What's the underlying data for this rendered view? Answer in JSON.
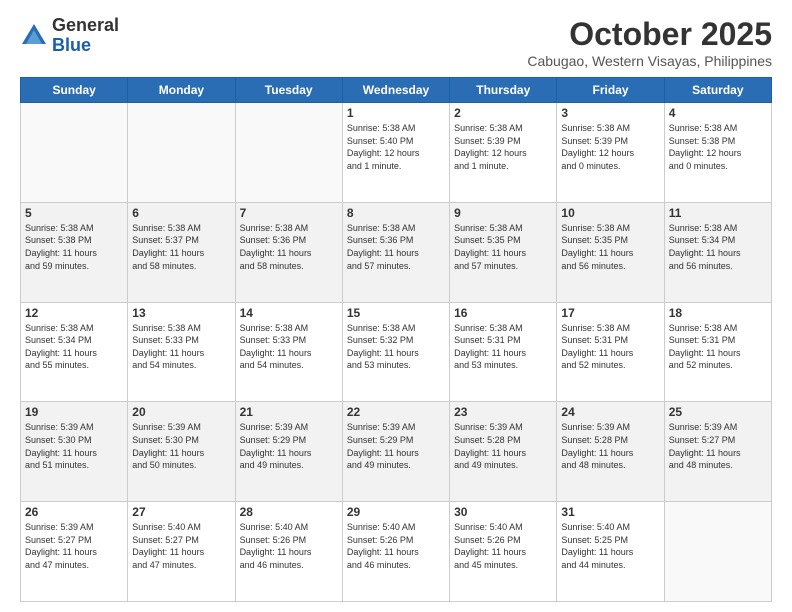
{
  "logo": {
    "general": "General",
    "blue": "Blue"
  },
  "header": {
    "month": "October 2025",
    "location": "Cabugao, Western Visayas, Philippines"
  },
  "days": [
    "Sunday",
    "Monday",
    "Tuesday",
    "Wednesday",
    "Thursday",
    "Friday",
    "Saturday"
  ],
  "weeks": [
    [
      {
        "day": "",
        "info": ""
      },
      {
        "day": "",
        "info": ""
      },
      {
        "day": "",
        "info": ""
      },
      {
        "day": "1",
        "info": "Sunrise: 5:38 AM\nSunset: 5:40 PM\nDaylight: 12 hours\nand 1 minute."
      },
      {
        "day": "2",
        "info": "Sunrise: 5:38 AM\nSunset: 5:39 PM\nDaylight: 12 hours\nand 1 minute."
      },
      {
        "day": "3",
        "info": "Sunrise: 5:38 AM\nSunset: 5:39 PM\nDaylight: 12 hours\nand 0 minutes."
      },
      {
        "day": "4",
        "info": "Sunrise: 5:38 AM\nSunset: 5:38 PM\nDaylight: 12 hours\nand 0 minutes."
      }
    ],
    [
      {
        "day": "5",
        "info": "Sunrise: 5:38 AM\nSunset: 5:38 PM\nDaylight: 11 hours\nand 59 minutes."
      },
      {
        "day": "6",
        "info": "Sunrise: 5:38 AM\nSunset: 5:37 PM\nDaylight: 11 hours\nand 58 minutes."
      },
      {
        "day": "7",
        "info": "Sunrise: 5:38 AM\nSunset: 5:36 PM\nDaylight: 11 hours\nand 58 minutes."
      },
      {
        "day": "8",
        "info": "Sunrise: 5:38 AM\nSunset: 5:36 PM\nDaylight: 11 hours\nand 57 minutes."
      },
      {
        "day": "9",
        "info": "Sunrise: 5:38 AM\nSunset: 5:35 PM\nDaylight: 11 hours\nand 57 minutes."
      },
      {
        "day": "10",
        "info": "Sunrise: 5:38 AM\nSunset: 5:35 PM\nDaylight: 11 hours\nand 56 minutes."
      },
      {
        "day": "11",
        "info": "Sunrise: 5:38 AM\nSunset: 5:34 PM\nDaylight: 11 hours\nand 56 minutes."
      }
    ],
    [
      {
        "day": "12",
        "info": "Sunrise: 5:38 AM\nSunset: 5:34 PM\nDaylight: 11 hours\nand 55 minutes."
      },
      {
        "day": "13",
        "info": "Sunrise: 5:38 AM\nSunset: 5:33 PM\nDaylight: 11 hours\nand 54 minutes."
      },
      {
        "day": "14",
        "info": "Sunrise: 5:38 AM\nSunset: 5:33 PM\nDaylight: 11 hours\nand 54 minutes."
      },
      {
        "day": "15",
        "info": "Sunrise: 5:38 AM\nSunset: 5:32 PM\nDaylight: 11 hours\nand 53 minutes."
      },
      {
        "day": "16",
        "info": "Sunrise: 5:38 AM\nSunset: 5:31 PM\nDaylight: 11 hours\nand 53 minutes."
      },
      {
        "day": "17",
        "info": "Sunrise: 5:38 AM\nSunset: 5:31 PM\nDaylight: 11 hours\nand 52 minutes."
      },
      {
        "day": "18",
        "info": "Sunrise: 5:38 AM\nSunset: 5:31 PM\nDaylight: 11 hours\nand 52 minutes."
      }
    ],
    [
      {
        "day": "19",
        "info": "Sunrise: 5:39 AM\nSunset: 5:30 PM\nDaylight: 11 hours\nand 51 minutes."
      },
      {
        "day": "20",
        "info": "Sunrise: 5:39 AM\nSunset: 5:30 PM\nDaylight: 11 hours\nand 50 minutes."
      },
      {
        "day": "21",
        "info": "Sunrise: 5:39 AM\nSunset: 5:29 PM\nDaylight: 11 hours\nand 49 minutes."
      },
      {
        "day": "22",
        "info": "Sunrise: 5:39 AM\nSunset: 5:29 PM\nDaylight: 11 hours\nand 49 minutes."
      },
      {
        "day": "23",
        "info": "Sunrise: 5:39 AM\nSunset: 5:28 PM\nDaylight: 11 hours\nand 49 minutes."
      },
      {
        "day": "24",
        "info": "Sunrise: 5:39 AM\nSunset: 5:28 PM\nDaylight: 11 hours\nand 48 minutes."
      },
      {
        "day": "25",
        "info": "Sunrise: 5:39 AM\nSunset: 5:27 PM\nDaylight: 11 hours\nand 48 minutes."
      }
    ],
    [
      {
        "day": "26",
        "info": "Sunrise: 5:39 AM\nSunset: 5:27 PM\nDaylight: 11 hours\nand 47 minutes."
      },
      {
        "day": "27",
        "info": "Sunrise: 5:40 AM\nSunset: 5:27 PM\nDaylight: 11 hours\nand 47 minutes."
      },
      {
        "day": "28",
        "info": "Sunrise: 5:40 AM\nSunset: 5:26 PM\nDaylight: 11 hours\nand 46 minutes."
      },
      {
        "day": "29",
        "info": "Sunrise: 5:40 AM\nSunset: 5:26 PM\nDaylight: 11 hours\nand 46 minutes."
      },
      {
        "day": "30",
        "info": "Sunrise: 5:40 AM\nSunset: 5:26 PM\nDaylight: 11 hours\nand 45 minutes."
      },
      {
        "day": "31",
        "info": "Sunrise: 5:40 AM\nSunset: 5:25 PM\nDaylight: 11 hours\nand 44 minutes."
      },
      {
        "day": "",
        "info": ""
      }
    ]
  ]
}
